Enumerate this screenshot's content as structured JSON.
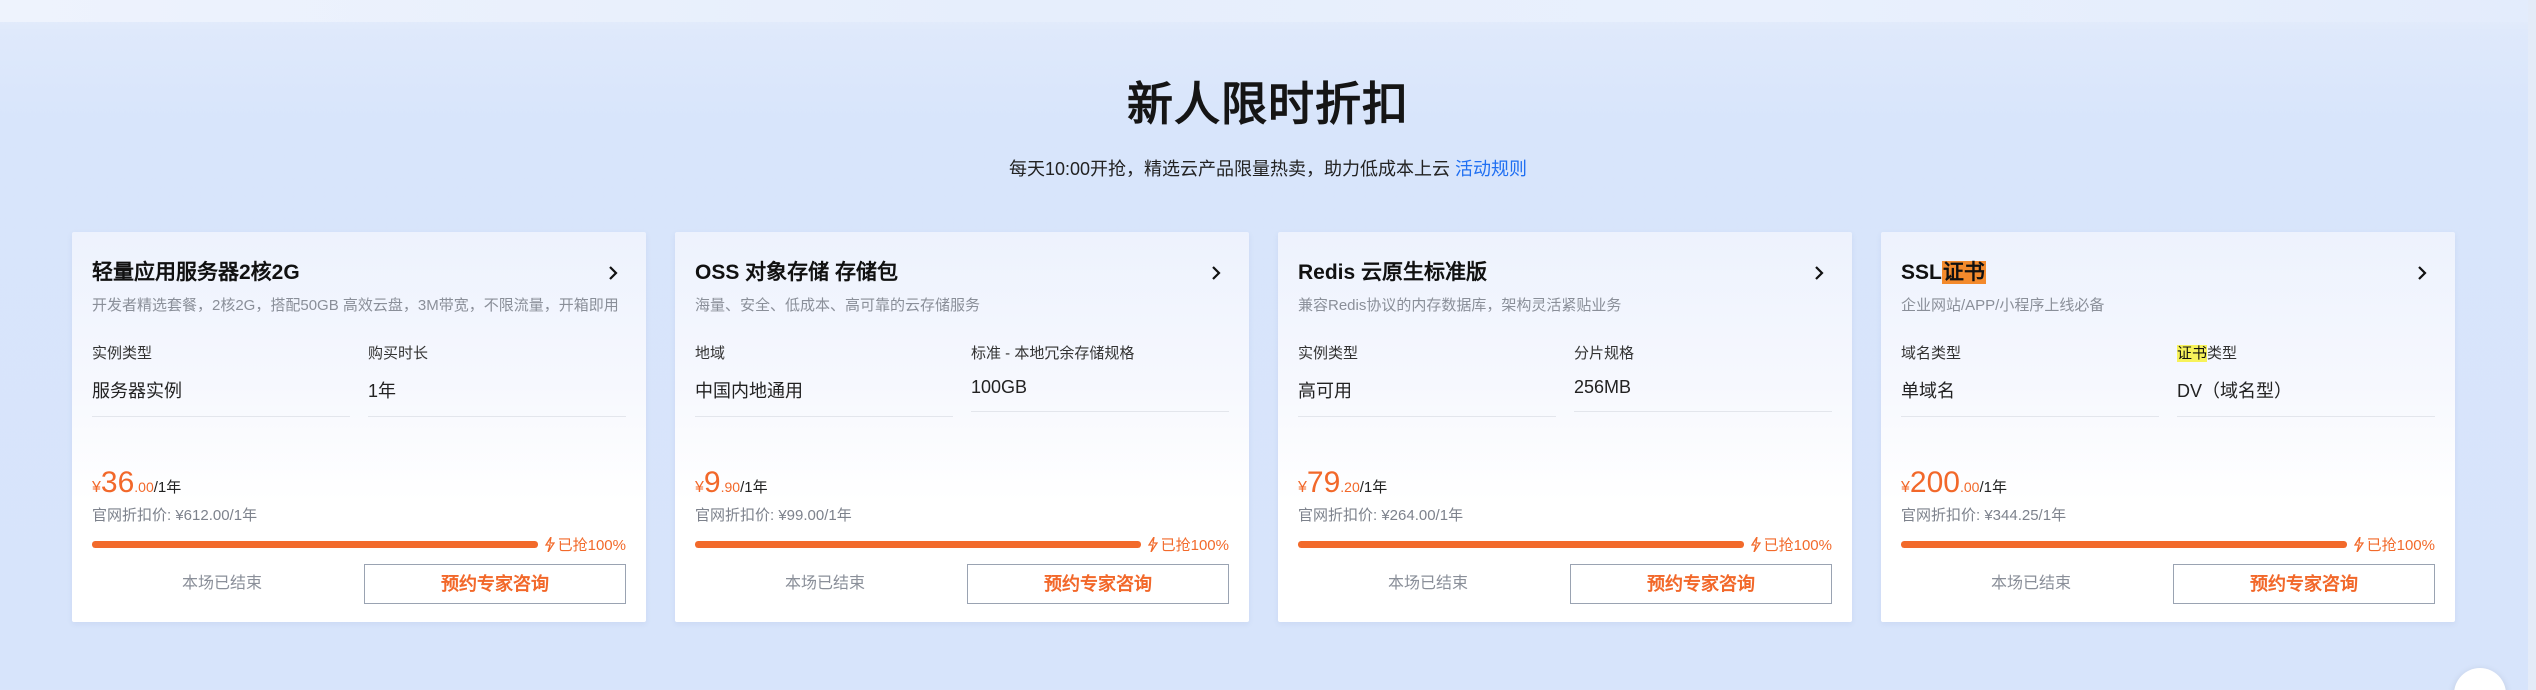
{
  "section": {
    "title": "新人限时折扣",
    "subtitle": "每天10:00开抢，精选云产品限量热卖，助力低成本上云",
    "rules_link": "活动规则"
  },
  "cards": [
    {
      "title": "轻量应用服务器2核2G",
      "desc": "开发者精选套餐，2核2G，搭配50GB 高效云盘，3M带宽，不限流量，开箱即用",
      "spec1_label": "实例类型",
      "spec1_value": "服务器实例",
      "spec2_label": "购买时长",
      "spec2_value": "1年",
      "price_currency": "¥",
      "price_int": "36",
      "price_dec": ".00",
      "price_unit": "/1年",
      "orig_price": "官网折扣价: ¥612.00/1年",
      "sold_text": "已抢100%",
      "sold_fraction": 1.0,
      "ended": "本场已结束",
      "consult": "预约专家咨询"
    },
    {
      "title": "OSS 对象存储 存储包",
      "desc": "海量、安全、低成本、高可靠的云存储服务",
      "spec1_label": "地域",
      "spec1_value": "中国内地通用",
      "spec2_label": "标准 - 本地冗余存储规格",
      "spec2_value": "100GB",
      "price_currency": "¥",
      "price_int": "9",
      "price_dec": ".90",
      "price_unit": "/1年",
      "orig_price": "官网折扣价: ¥99.00/1年",
      "sold_text": "已抢100%",
      "sold_fraction": 1.0,
      "ended": "本场已结束",
      "consult": "预约专家咨询"
    },
    {
      "title": "Redis 云原生标准版",
      "desc": "兼容Redis协议的内存数据库，架构灵活紧贴业务",
      "spec1_label": "实例类型",
      "spec1_value": "高可用",
      "spec2_label": "分片规格",
      "spec2_value": "256MB",
      "price_currency": "¥",
      "price_int": "79",
      "price_dec": ".20",
      "price_unit": "/1年",
      "orig_price": "官网折扣价: ¥264.00/1年",
      "sold_text": "已抢100%",
      "sold_fraction": 1.0,
      "ended": "本场已结束",
      "consult": "预约专家咨询"
    },
    {
      "title_prefix": "SSL",
      "title_highlight": "证书",
      "desc": "企业网站/APP/小程序上线必备",
      "spec1_label": "域名类型",
      "spec1_value": "单域名",
      "spec2_label_highlight": "证书",
      "spec2_label_rest": "类型",
      "spec2_value": "DV（域名型）",
      "price_currency": "¥",
      "price_int": "200",
      "price_dec": ".00",
      "price_unit": "/1年",
      "orig_price": "官网折扣价: ¥344.25/1年",
      "sold_text": "已抢100%",
      "sold_fraction": 1.0,
      "ended": "本场已结束",
      "consult": "预约专家咨询"
    }
  ],
  "colors": {
    "accent_orange": "#f2682a",
    "link_blue": "#1f6ff2",
    "page_bg": "#d8e5fb"
  }
}
